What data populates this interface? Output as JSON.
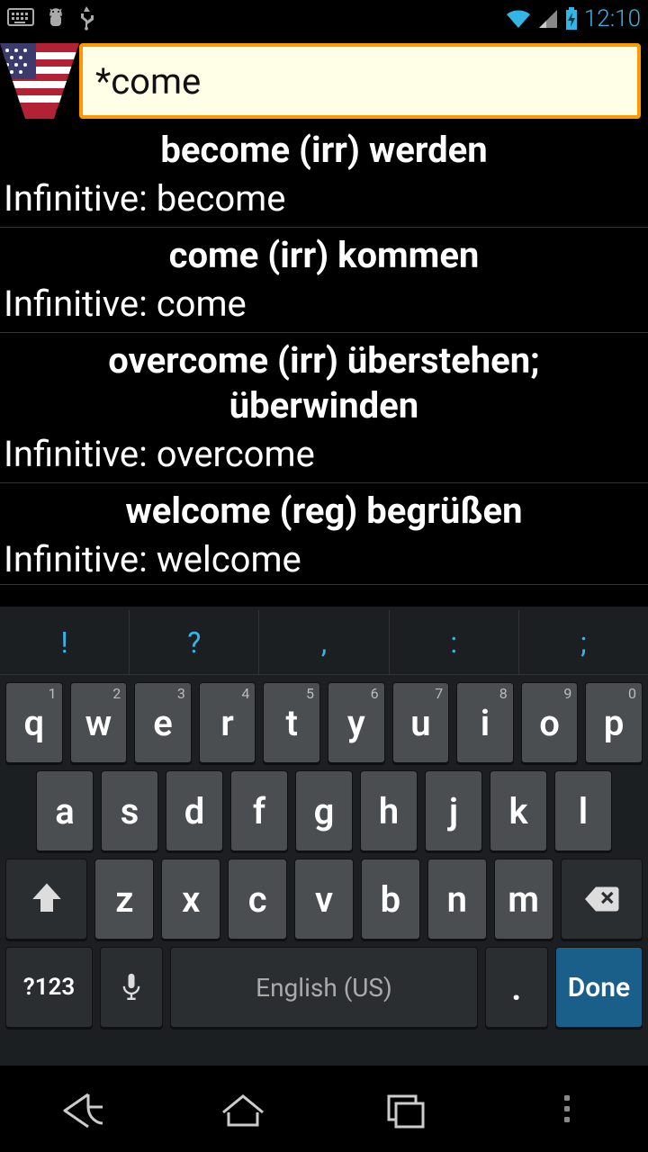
{
  "status": {
    "time": "12:10"
  },
  "search": {
    "value": "*come"
  },
  "results": [
    {
      "title": "become (irr) werden",
      "sub": "Infinitive: become"
    },
    {
      "title": "come (irr) kommen",
      "sub": "Infinitive: come"
    },
    {
      "title": "overcome (irr) überstehen; überwinden",
      "sub": "Infinitive: overcome"
    },
    {
      "title": "welcome (reg) begrüßen",
      "sub": "Infinitive: welcome"
    }
  ],
  "keyboard": {
    "suggestions": [
      "!",
      "?",
      ",",
      ":",
      ";"
    ],
    "row1": [
      {
        "k": "q",
        "s": "1"
      },
      {
        "k": "w",
        "s": "2"
      },
      {
        "k": "e",
        "s": "3"
      },
      {
        "k": "r",
        "s": "4"
      },
      {
        "k": "t",
        "s": "5"
      },
      {
        "k": "y",
        "s": "6"
      },
      {
        "k": "u",
        "s": "7"
      },
      {
        "k": "i",
        "s": "8"
      },
      {
        "k": "o",
        "s": "9"
      },
      {
        "k": "p",
        "s": "0"
      }
    ],
    "row2": [
      "a",
      "s",
      "d",
      "f",
      "g",
      "h",
      "j",
      "k",
      "l"
    ],
    "row3": [
      "z",
      "x",
      "c",
      "v",
      "b",
      "n",
      "m"
    ],
    "sym": "?123",
    "space": "English (US)",
    "period": ".",
    "done": "Done"
  }
}
